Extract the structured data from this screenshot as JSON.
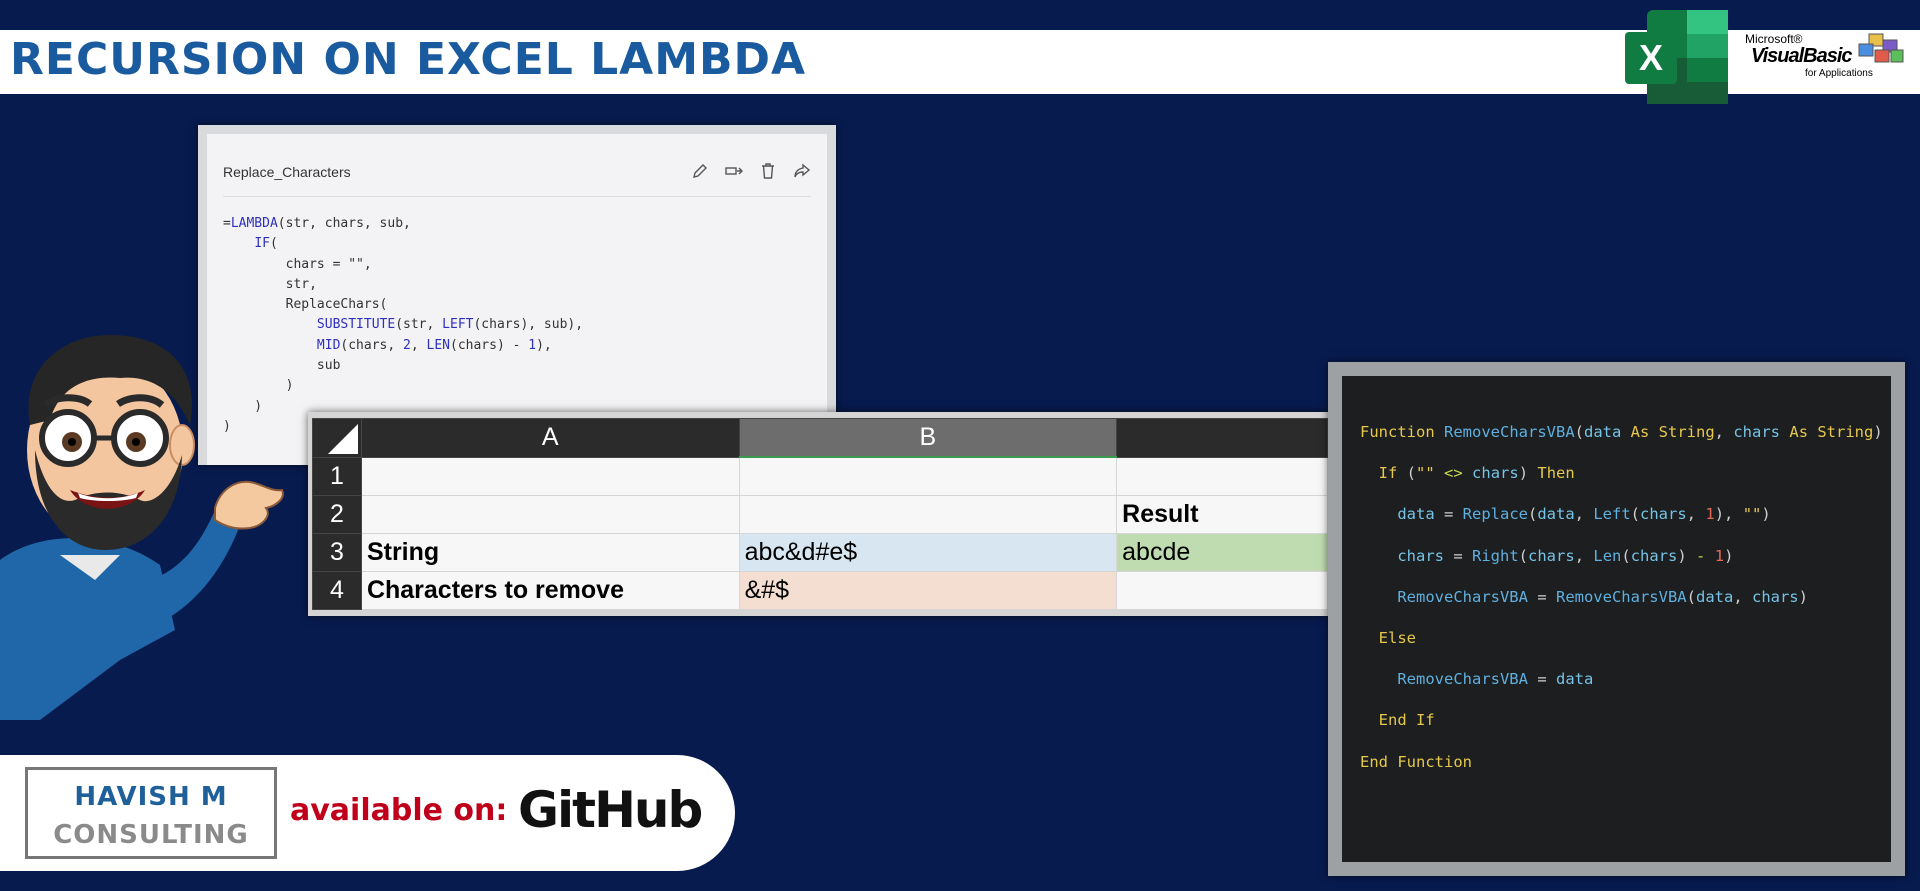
{
  "header": {
    "title": "RECURSION ON EXCEL LAMBDA"
  },
  "logos": {
    "excel_icon": "excel-icon",
    "vba": {
      "microsoft": "Microsoft®",
      "visual_basic": "VisualBasic",
      "for_applications": "for Applications"
    }
  },
  "lambda_panel": {
    "name": "Replace_Characters",
    "tools": [
      "pencil-icon",
      "rename-icon",
      "trash-icon",
      "share-icon"
    ]
  },
  "sheet": {
    "columns": [
      "A",
      "B"
    ],
    "rows": [
      "1",
      "2",
      "3",
      "4"
    ],
    "result_label": "Result",
    "string_label": "String",
    "string_value": "abc&d#e$",
    "result_value": "abcde",
    "chars_label": "Characters to remove",
    "chars_value": "&#$"
  },
  "footer": {
    "brand_line1": "HAVISH M",
    "brand_line2": "CONSULTING",
    "available_label": "available on:",
    "platform": "GitHub"
  },
  "colors": {
    "background": "#081b4f",
    "title": "#1a5a9e",
    "string_fill": "#d8e6f1",
    "chars_fill": "#f4ddd1",
    "result_fill": "#bfdcb0",
    "available": "#c0001a"
  }
}
